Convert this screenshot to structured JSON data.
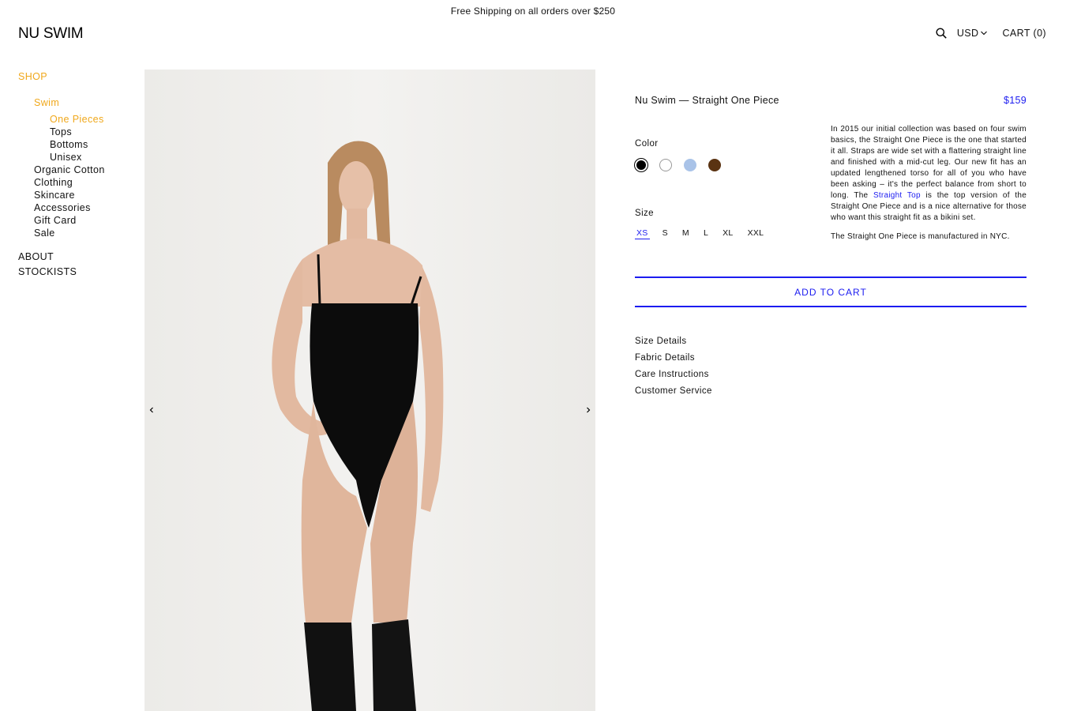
{
  "announcement": "Free Shipping on all orders over $250",
  "brand": "NU SWIM",
  "header": {
    "search_icon": "search-icon",
    "currency": "USD",
    "cart": "CART (0)"
  },
  "nav": {
    "shop": "SHOP",
    "swim": "Swim",
    "swim_items": [
      "One Pieces",
      "Tops",
      "Bottoms",
      "Unisex"
    ],
    "items": [
      "Organic Cotton",
      "Clothing",
      "Skincare",
      "Accessories",
      "Gift Card",
      "Sale"
    ],
    "about": "ABOUT",
    "stockists": "STOCKISTS"
  },
  "product": {
    "title": "Nu Swim — Straight One Piece",
    "price": "$159",
    "color_label": "Color",
    "colors": [
      "#000000",
      "#ffffff",
      "#a9c3e8",
      "#5a3312"
    ],
    "selected_color": 0,
    "size_label": "Size",
    "sizes": [
      "XS",
      "S",
      "M",
      "L",
      "XL",
      "XXL"
    ],
    "selected_size": "XS",
    "description_before_link": "In 2015 our initial collection was based on four swim basics, the Straight One Piece is the one that started it all. Straps are wide set with a flattering straight line and finished with a mid-cut leg. Our new fit has an updated lengthened torso for all of you who have been asking – it's the perfect balance from short to long. The ",
    "description_link": "Straight Top",
    "description_after_link": " is the top version of the Straight One Piece and is a nice alternative for those who want this straight fit as a bikini set.",
    "description_2": "The Straight One Piece is manufactured in NYC.",
    "add_to_cart": "ADD TO CART",
    "details": [
      "Size Details",
      "Fabric Details",
      "Care Instructions",
      "Customer Service"
    ]
  },
  "accent_color": "#1c1cf0",
  "highlight_color": "#f0a81c"
}
